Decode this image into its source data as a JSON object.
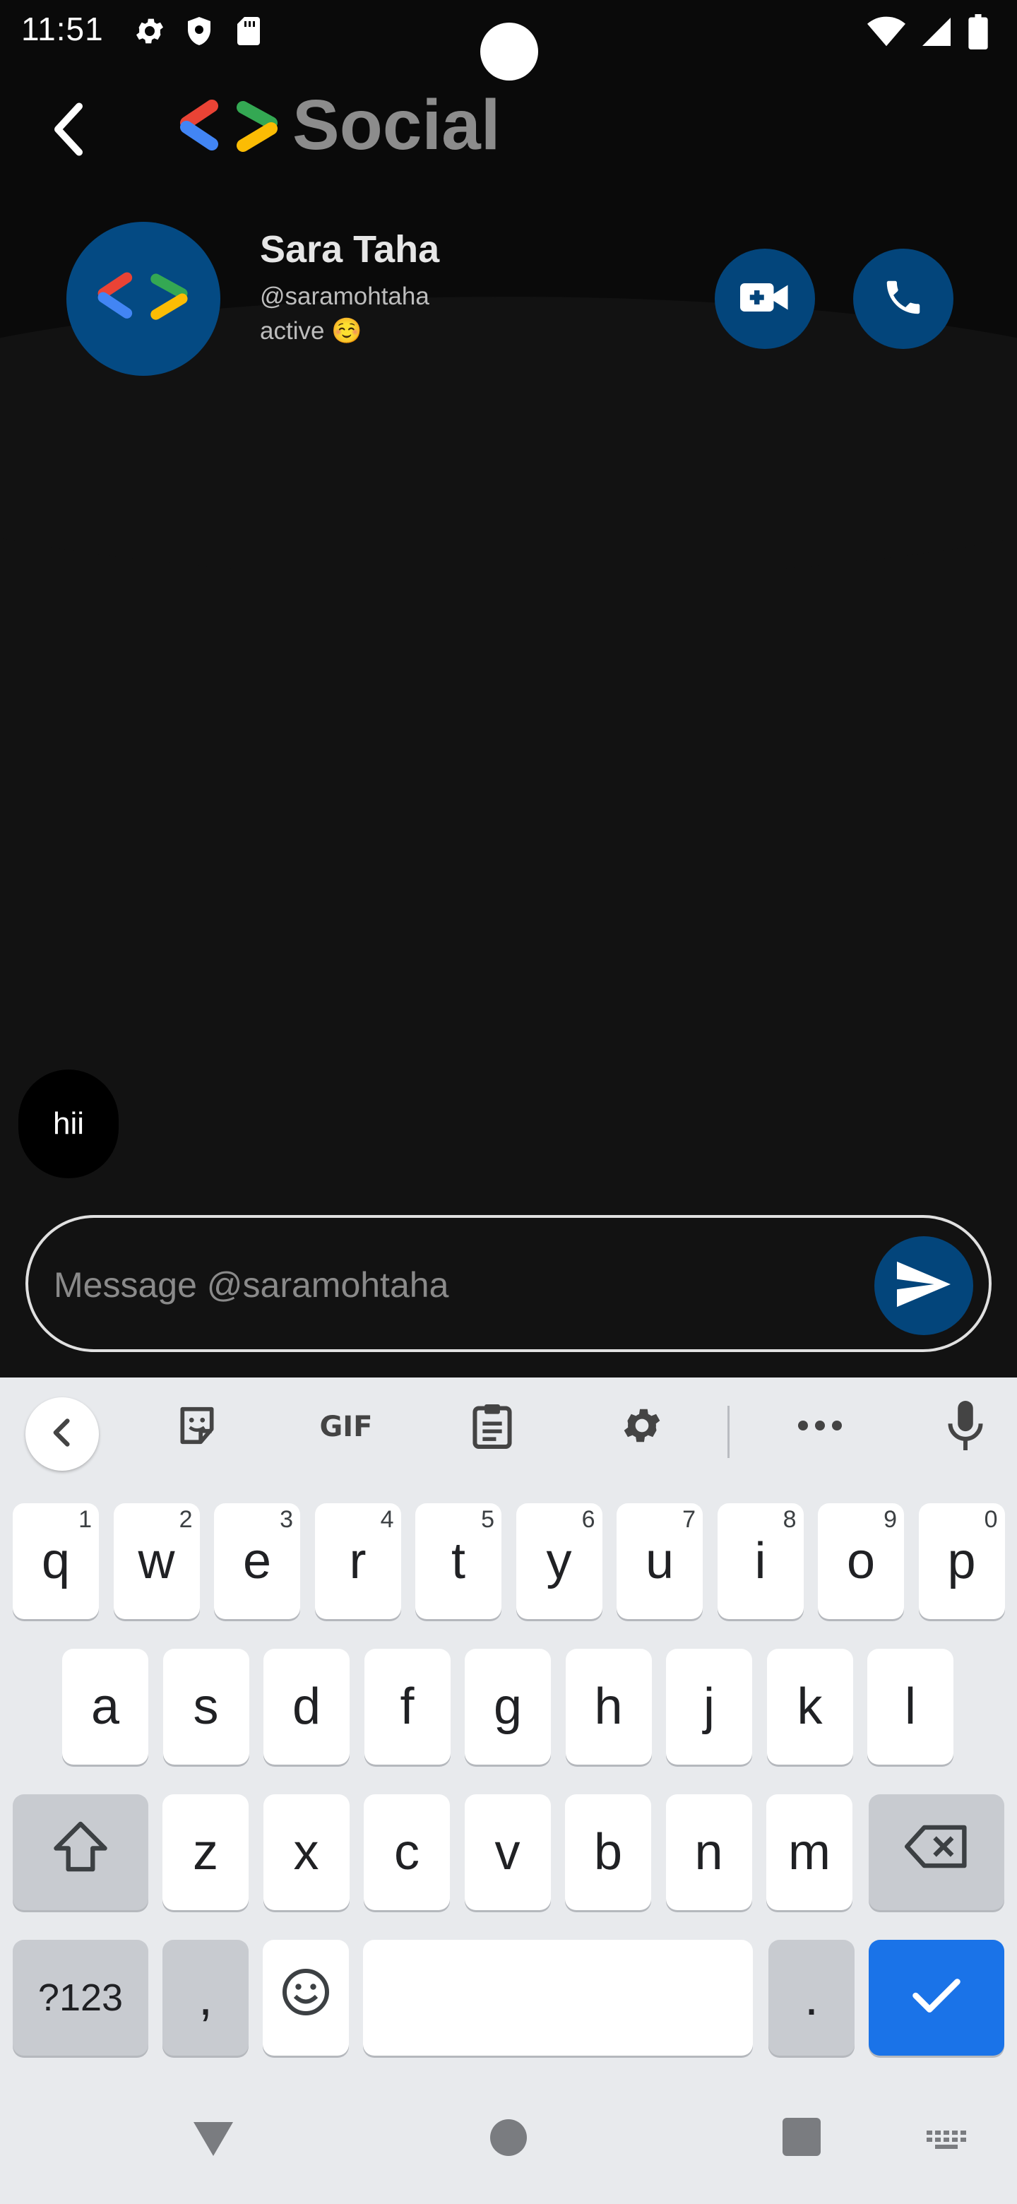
{
  "status_bar": {
    "time": "11:51",
    "left_icons": [
      "gear-icon",
      "shield-icon",
      "sd-card-icon"
    ],
    "right_icons": [
      "wifi-icon",
      "signal-icon",
      "battery-icon"
    ]
  },
  "header": {
    "brand_name": "Social",
    "logo_colors": [
      "#ea4335",
      "#4285f4",
      "#34a853",
      "#fbbc04"
    ]
  },
  "contact": {
    "name": "Sara Taha",
    "handle": "@saramohtaha",
    "status": "active ☺️",
    "actions": [
      {
        "name": "video-call",
        "icon": "video-plus-icon"
      },
      {
        "name": "voice-call",
        "icon": "phone-icon"
      }
    ]
  },
  "messages": [
    {
      "text": "hii"
    }
  ],
  "composer": {
    "placeholder": "Message @saramohtaha",
    "send_icon": "send-icon"
  },
  "keyboard": {
    "toolbar": [
      "collapse-icon",
      "sticker-icon",
      "GIF",
      "clipboard-icon",
      "gear-icon",
      "more-icon",
      "mic-icon"
    ],
    "row1": [
      {
        "key": "q",
        "hint": "1"
      },
      {
        "key": "w",
        "hint": "2"
      },
      {
        "key": "e",
        "hint": "3"
      },
      {
        "key": "r",
        "hint": "4"
      },
      {
        "key": "t",
        "hint": "5"
      },
      {
        "key": "y",
        "hint": "6"
      },
      {
        "key": "u",
        "hint": "7"
      },
      {
        "key": "i",
        "hint": "8"
      },
      {
        "key": "o",
        "hint": "9"
      },
      {
        "key": "p",
        "hint": "0"
      }
    ],
    "row2": [
      "a",
      "s",
      "d",
      "f",
      "g",
      "h",
      "j",
      "k",
      "l"
    ],
    "row3": [
      "z",
      "x",
      "c",
      "v",
      "b",
      "n",
      "m"
    ],
    "symbols_label": "?123",
    "comma": ",",
    "period": ".",
    "accent_color": "#1a73e8"
  },
  "nav_bar": [
    "back-triangle-icon",
    "home-circle-icon",
    "recents-square-icon",
    "keyboard-switch-icon"
  ],
  "colors": {
    "accent_button": "#03457b",
    "background": "#121212"
  }
}
